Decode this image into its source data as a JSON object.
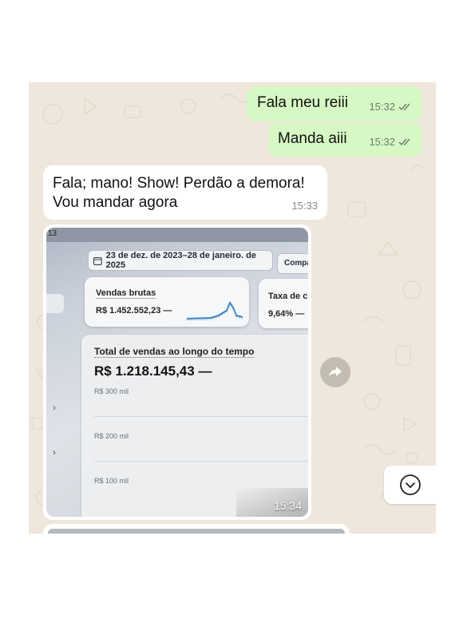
{
  "messages": [
    {
      "text": "Fala meu reiii",
      "time": "15:32",
      "status": "read"
    },
    {
      "text": "Manda aiii",
      "time": "15:32",
      "status": "read"
    },
    {
      "line1": "Fala; mano! Show! Perdão a demora!",
      "line2": "Vou mandar agora",
      "time": "15:33"
    }
  ],
  "photo": {
    "corner_label": "13",
    "date_range": "23 de dez. de 2023–28 de janeiro. de 2025",
    "compare_label": "Compa",
    "card1": {
      "label": "Vendas brutas",
      "value": "R$ 1.452.552,23 —"
    },
    "card2": {
      "label": "Taxa de c",
      "value": "9,64% —"
    },
    "chart": {
      "title": "Total de vendas ao longo do tempo",
      "total": "R$ 1.218.145,43 —",
      "ticks": [
        "R$ 300 mil",
        "R$ 200 mil",
        "R$ 100 mil"
      ]
    },
    "time": "15:34"
  },
  "colors": {
    "chat_background": "#efe7dc",
    "outgoing_bubble": "#d7f8c4",
    "incoming_bubble": "#ffffff",
    "read_ticks": "#6b7a6d",
    "sparkline": "#3b82c4"
  },
  "icons": [
    "double-check-icon",
    "calendar-icon",
    "forward-icon",
    "chevron-down-icon",
    "chevron-right-icon"
  ]
}
